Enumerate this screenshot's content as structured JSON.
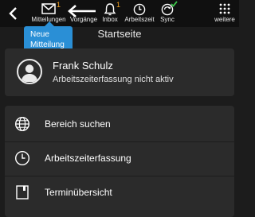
{
  "toolbar": {
    "items": [
      {
        "label": "Mitteilungen",
        "badge": "1"
      },
      {
        "label": "Vorgänge"
      },
      {
        "label": "Inbox",
        "badge": "1"
      },
      {
        "label": "Arbeitszeit"
      },
      {
        "label": "Sync",
        "status": "synced"
      },
      {
        "label": "weitere"
      }
    ]
  },
  "tooltip": {
    "line1": "Neue",
    "line2": "Mitteilung"
  },
  "page": {
    "title": "Startseite"
  },
  "profile": {
    "name": "Frank Schulz",
    "status": "Arbeitszeiterfassung nicht aktiv"
  },
  "menu": {
    "items": [
      {
        "label": "Bereich suchen",
        "icon": "globe-icon"
      },
      {
        "label": "Arbeitszeiterfassung",
        "icon": "clock-icon"
      },
      {
        "label": "Terminübersicht",
        "icon": "calendar-icon"
      }
    ]
  },
  "colors": {
    "background": "#1c1c1c",
    "topbar": "#101010",
    "card": "#2b2b2b",
    "accent": "#2a8fd6",
    "badge": "#f0a020",
    "sync_check": "#3cc24a"
  }
}
